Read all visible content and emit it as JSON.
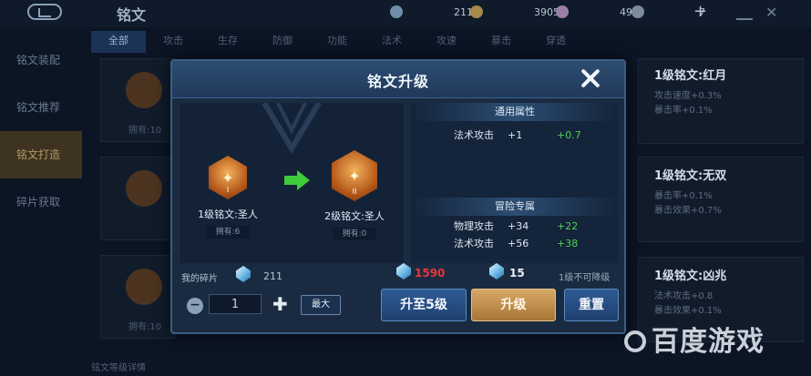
{
  "background": {
    "title": "铭文",
    "resources": [
      {
        "icon": "gem-icon",
        "value": "211"
      },
      {
        "icon": "coin-icon",
        "value": "3905"
      },
      {
        "icon": "diamond-icon",
        "value": "494"
      },
      {
        "icon": "chip-icon",
        "value": "7"
      }
    ],
    "tabs": [
      "全部",
      "攻击",
      "生存",
      "防御",
      "功能",
      "法术",
      "攻速",
      "暴击",
      "穿透"
    ],
    "sidebar": [
      "铭文装配",
      "铭文推荐",
      "铭文打造",
      "碎片获取"
    ],
    "card_own": "拥有:10",
    "right_items": [
      {
        "name": "1级铭文:红月",
        "stats": [
          "攻击速度+0.3%",
          "暴击率+0.1%"
        ]
      },
      {
        "name": "1级铭文:无双",
        "stats": [
          "暴击率+0.1%",
          "暴击效果+0.7%"
        ]
      },
      {
        "name": "1级铭文:凶兆",
        "stats": [
          "法术攻击+0.8",
          "暴击效果+0.1%"
        ]
      }
    ],
    "bottom_text": "铭文等级详情",
    "watermark": "百度游戏"
  },
  "dialog": {
    "title": "铭文升级",
    "from_rune": {
      "name": "1级铭文:圣人",
      "owned": "拥有:6",
      "level": "I"
    },
    "to_rune": {
      "name": "2级铭文:圣人",
      "owned": "拥有:0",
      "level": "II"
    },
    "common_title": "通用属性",
    "common_stats": [
      {
        "name": "法术攻击",
        "value": "+1",
        "delta": "+0.7"
      }
    ],
    "adventure_title": "冒险专属",
    "adventure_stats": [
      {
        "name": "物理攻击",
        "value": "+34",
        "delta": "+22"
      },
      {
        "name": "法术攻击",
        "value": "+56",
        "delta": "+38"
      }
    ],
    "fragments_label": "我的碎片",
    "fragments_count": "211",
    "cost_required": "1590",
    "cost_alt": "15",
    "note": "1级不可降级",
    "quantity": "1",
    "max_label": "最大",
    "btn_upgrade_to": "升至5级",
    "btn_upgrade": "升级",
    "btn_reset": "重置",
    "colors": {
      "cost_insufficient": "#e8363a",
      "stat_increase": "#52d052",
      "upgrade_gold": "#c9934a"
    }
  }
}
